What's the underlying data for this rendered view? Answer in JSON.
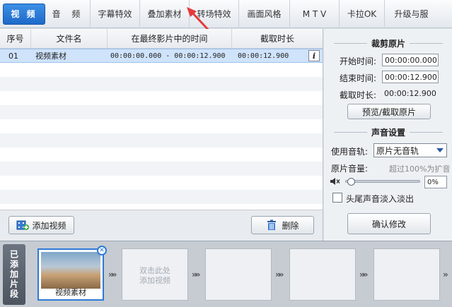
{
  "tabs": [
    {
      "label": "视 频",
      "active": true
    },
    {
      "label": "音 频"
    },
    {
      "label": "字幕特效"
    },
    {
      "label": "叠加素材"
    },
    {
      "label": "转场特效"
    },
    {
      "label": "画面风格"
    },
    {
      "label": "M T V"
    },
    {
      "label": "卡拉OK"
    },
    {
      "label": "升级与服"
    }
  ],
  "table": {
    "columns": [
      "序号",
      "文件名",
      "在最终影片中的时间",
      "截取时长"
    ],
    "rows": [
      {
        "index": "01",
        "name": "视频素材",
        "timeline": "00:00:00.000 - 00:00:12.900",
        "duration": "00:00:12.900"
      }
    ]
  },
  "buttons": {
    "add_video": "添加视频",
    "delete": "删除"
  },
  "trim": {
    "title": "裁剪原片",
    "start_label": "开始时间:",
    "start_value": "00:00:00.000",
    "end_label": "结束时间:",
    "end_value": "00:00:12.900",
    "duration_label": "截取时长:",
    "duration_value": "00:00:12.900",
    "preview_button": "预览/截取原片"
  },
  "audio": {
    "title": "声音设置",
    "track_label": "使用音轨:",
    "track_value": "原片无音轨",
    "volume_label": "原片音量:",
    "volume_hint": "超过100%为扩音",
    "volume_value": "0%",
    "fade_label": "头尾声音淡入淡出",
    "confirm_button": "确认修改"
  },
  "bottom": {
    "side_label": "已添加片段",
    "clip_name": "视频素材",
    "add_hint_1": "双击此处",
    "add_hint_2": "添加视频"
  },
  "colors": {
    "accent": "#1d6ac9",
    "selected_row": "#cfe3fb",
    "annotation_arrow": "#e53a3a"
  }
}
